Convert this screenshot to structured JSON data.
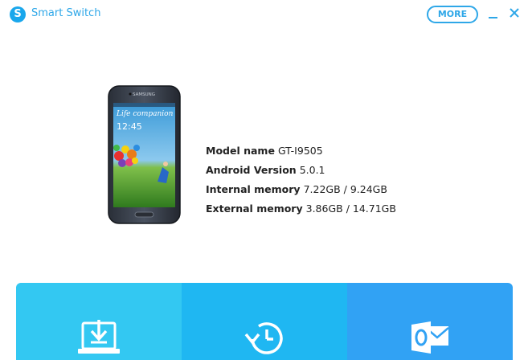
{
  "app": {
    "title": "Smart Switch",
    "logo_letter": "S",
    "more_label": "MORE",
    "accent_color": "#2ea7e8"
  },
  "window_controls": {
    "minimize_icon": "minimize-icon",
    "close_icon": "close-icon"
  },
  "phone": {
    "brand": "SAMSUNG",
    "wallpaper_text": "Life companion",
    "clock": "12:45"
  },
  "device_info": [
    {
      "label": "Model name",
      "value": "GT-I9505"
    },
    {
      "label": "Android Version",
      "value": "5.0.1"
    },
    {
      "label": "Internal memory",
      "value": "7.22GB / 9.24GB"
    },
    {
      "label": "External memory",
      "value": "3.86GB / 14.71GB"
    }
  ],
  "tiles": [
    {
      "icon": "backup-icon",
      "color": "#33c8f2"
    },
    {
      "icon": "restore-icon",
      "color": "#1fb7f2"
    },
    {
      "icon": "outlook-sync-icon",
      "color": "#31a2f4"
    }
  ]
}
